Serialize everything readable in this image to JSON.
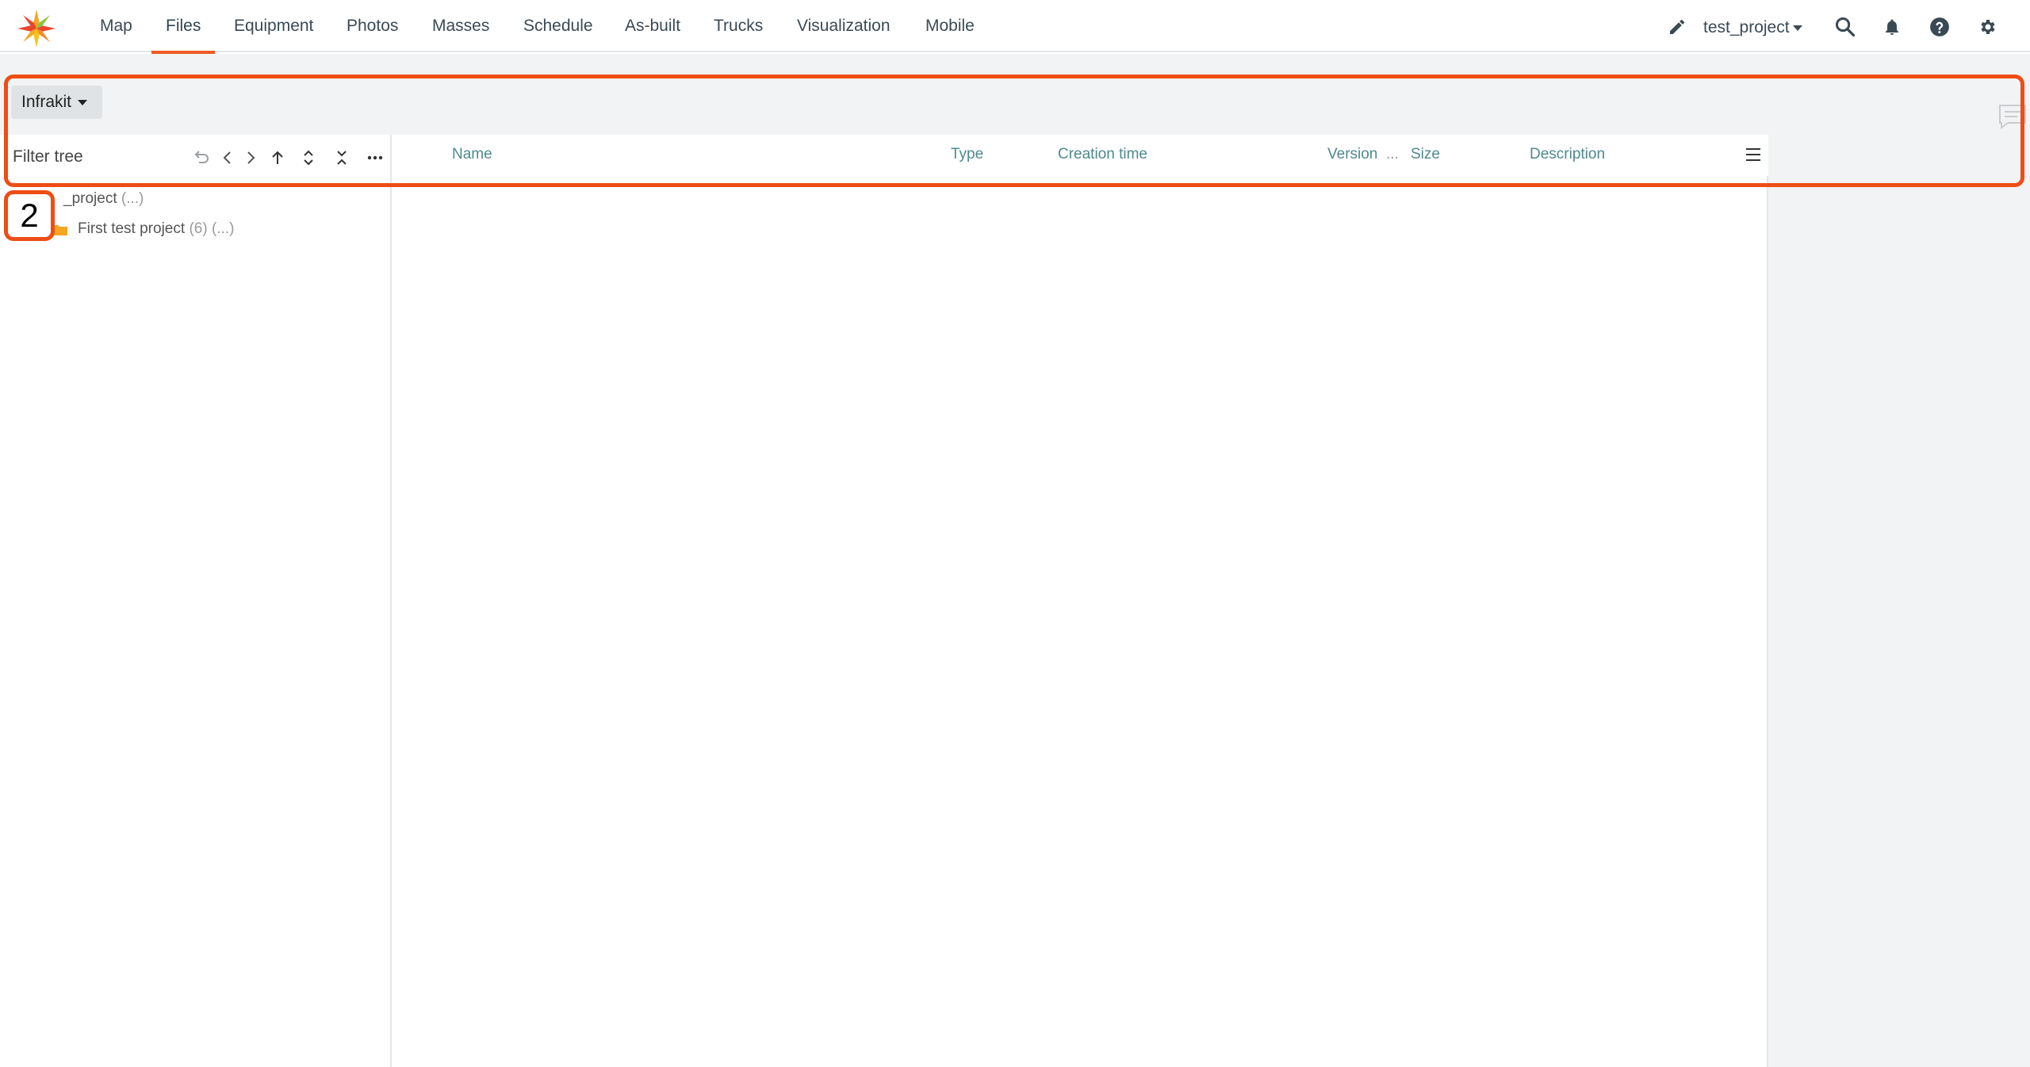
{
  "nav": {
    "items": [
      {
        "label": "Map"
      },
      {
        "label": "Files"
      },
      {
        "label": "Equipment"
      },
      {
        "label": "Photos"
      },
      {
        "label": "Masses"
      },
      {
        "label": "Schedule"
      },
      {
        "label": "As-built"
      },
      {
        "label": "Trucks"
      },
      {
        "label": "Visualization"
      },
      {
        "label": "Mobile"
      }
    ],
    "active": "Files",
    "project": "test_project",
    "icons": [
      "pencil-icon",
      "search-icon",
      "bell-icon",
      "help-icon",
      "gear-icon"
    ]
  },
  "source": {
    "label": "Infrakit"
  },
  "tree": {
    "filter_placeholder": "Filter tree",
    "toolbar_icons": [
      "undo-icon",
      "back-icon",
      "forward-icon",
      "up-icon",
      "expand-icon",
      "collapse-icon",
      "more-icon"
    ],
    "nodes": [
      {
        "name": "_project",
        "suffix": "(...)"
      },
      {
        "name": "First test project",
        "count": "(6)",
        "suffix": "(...)"
      }
    ]
  },
  "list": {
    "columns": [
      "Name",
      "Type",
      "Creation time",
      "Version",
      "...",
      "Size",
      "Description"
    ]
  },
  "annotation": {
    "step": "2"
  },
  "colors": {
    "accent": "#ee5a24",
    "header_text": "#4e8a8d",
    "folder": "#f5a623"
  }
}
